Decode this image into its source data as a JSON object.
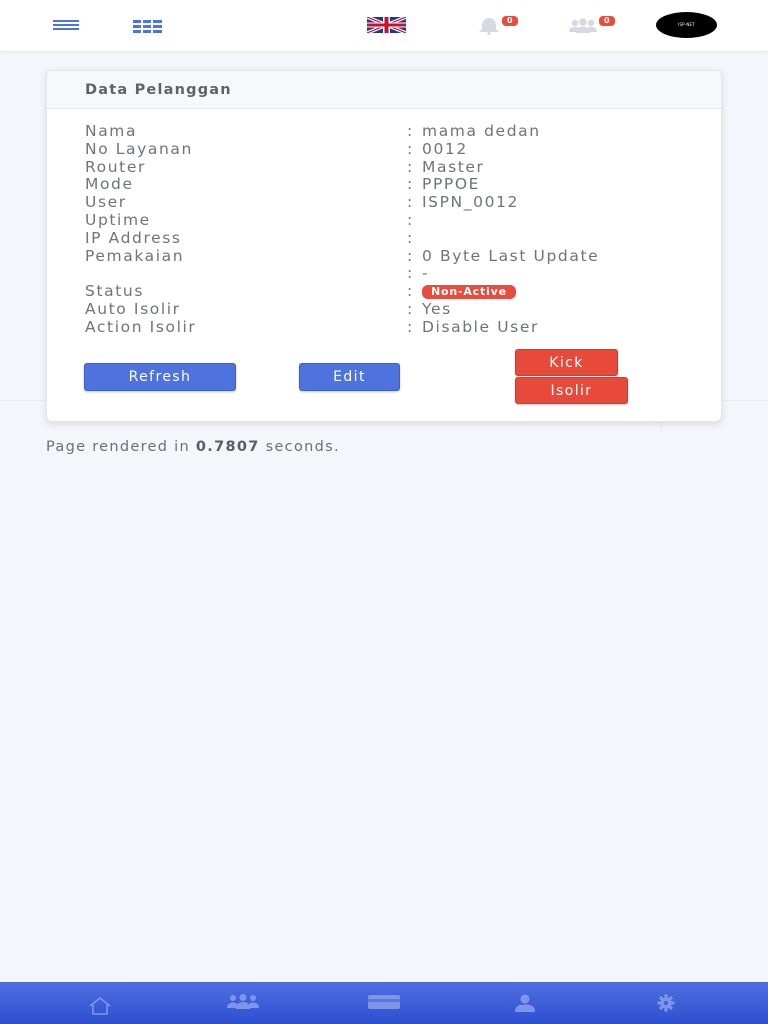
{
  "navbar": {
    "icons": [
      "menu-icon",
      "apps-icon",
      "uk-flag-icon",
      "bell-icon",
      "users-icon"
    ],
    "notifications_count": "0",
    "users_count": "0",
    "avatar_text": "ISP-NET"
  },
  "card": {
    "title": "Data Pelanggan",
    "rows": [
      {
        "label": "Nama",
        "sep": ":",
        "value": "mama dedan"
      },
      {
        "label": "No Layanan",
        "sep": ":",
        "value": "0012"
      },
      {
        "label": "Router",
        "sep": ":",
        "value": "Master"
      },
      {
        "label": "Mode",
        "sep": ":",
        "value": "PPPOE"
      },
      {
        "label": "User",
        "sep": ":",
        "value": "ISPN_0012"
      },
      {
        "label": "Uptime",
        "sep": ":",
        "value": ""
      },
      {
        "label": "IP Address",
        "sep": ":",
        "value": ""
      },
      {
        "label": "Pemakaian",
        "sep": ":",
        "value": "0 Byte Last Update"
      },
      {
        "label": "",
        "sep": ":",
        "value": "-"
      },
      {
        "label": "Status",
        "sep": ":",
        "value": "Non-Active"
      },
      {
        "label": "Auto Isolir",
        "sep": ":",
        "value": "Yes"
      },
      {
        "label": "Action Isolir",
        "sep": ":",
        "value": "Disable User"
      }
    ],
    "buttons": {
      "refresh": "Refresh",
      "edit": "Edit",
      "kick": "Kick",
      "isolir": "Isolir"
    }
  },
  "footer": {
    "prefix": "Page rendered in",
    "time": "0.7807",
    "suffix": "seconds."
  },
  "bottom_nav": {
    "icons": [
      "home-icon",
      "users-icon",
      "credit-card-icon",
      "user-icon",
      "gear-icon"
    ]
  },
  "colors": {
    "primary": "#4e73df",
    "danger": "#e74a3b",
    "background": "#f5f6fb",
    "text": "#6c6f77"
  }
}
